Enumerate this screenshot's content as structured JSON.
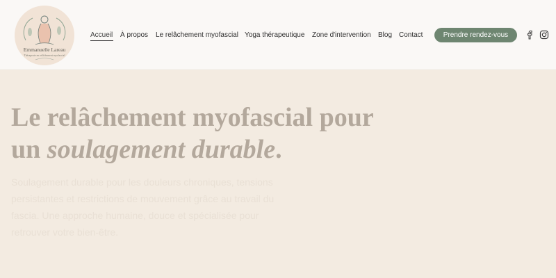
{
  "header": {
    "logo": {
      "name": "Emmanuelle Lareau",
      "tagline": "Thérapeute en relâchement myofascial",
      "colors": {
        "background": "#f1e3d6",
        "accent": "#8fa593"
      }
    },
    "nav": [
      {
        "label": "Accueil",
        "active": true
      },
      {
        "label": "À propos",
        "active": false
      },
      {
        "label": "Le relâchement myofascial",
        "active": false
      },
      {
        "label": "Yoga thérapeutique",
        "active": false
      },
      {
        "label": "Zone d'intervention",
        "active": false
      },
      {
        "label": "Blog",
        "active": false
      },
      {
        "label": "Contact",
        "active": false
      }
    ],
    "cta_label": "Prendre rendez-vous",
    "social": [
      {
        "icon": "facebook-icon"
      },
      {
        "icon": "instagram-icon"
      }
    ]
  },
  "hero": {
    "title_line1": "Le relâchement myofascial pour",
    "title_prefix": "un ",
    "title_emphasis": "soulagement durable",
    "title_suffix": ".",
    "description": "Soulagement durable pour les douleurs chroniques, tensions persistantes et restrictions de mouvement grâce au travail du fascia. Une approche humaine, douce et spécialisée pour retrouver votre bien-être."
  },
  "colors": {
    "page_background": "#f3ebe1",
    "header_background": "#faf8f6",
    "cta_background": "#6e8671",
    "title_color": "#b3a89c"
  }
}
